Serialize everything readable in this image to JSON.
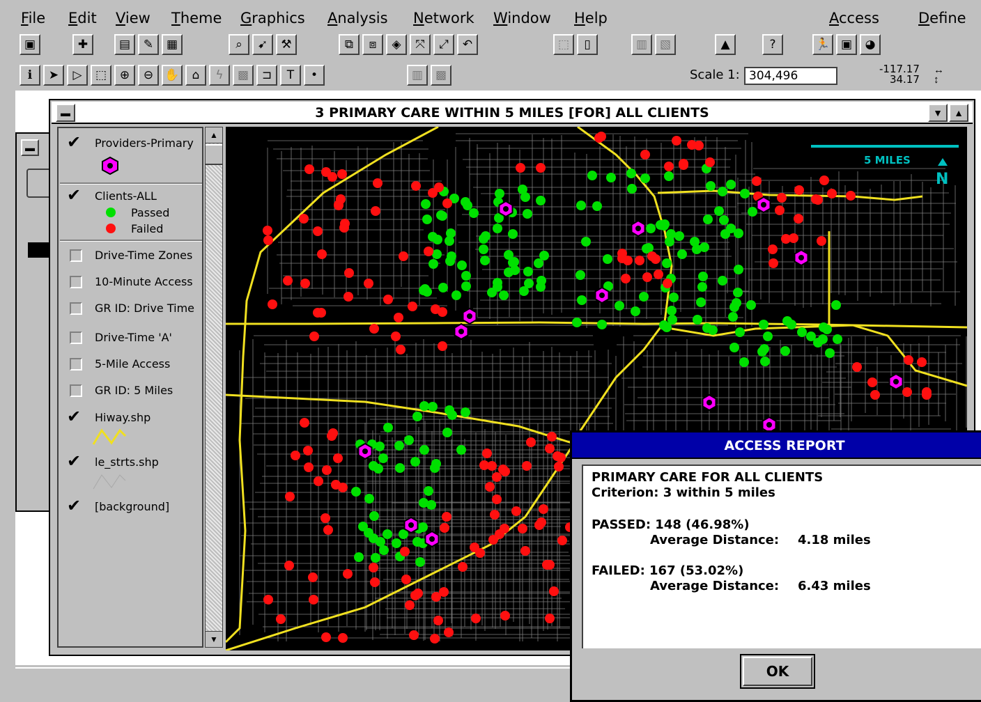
{
  "menubar": {
    "items": [
      "File",
      "Edit",
      "View",
      "Theme",
      "Graphics",
      "Analysis",
      "Network",
      "Window",
      "Help"
    ],
    "right_items": [
      "Access",
      "Define"
    ]
  },
  "toolbar": {
    "scale_label": "Scale 1:",
    "scale_value": "304,496",
    "coord_x": "-117.17",
    "coord_y": "34.17"
  },
  "view": {
    "title": "3 PRIMARY CARE WITHIN 5 MILES  [FOR]  ALL CLIENTS"
  },
  "legend": {
    "layers": [
      {
        "label": "Providers-Primary",
        "checked": true
      },
      {
        "label": "Clients-ALL",
        "checked": true,
        "sub": [
          "Passed",
          "Failed"
        ]
      },
      {
        "label": "Drive-Time Zones",
        "checked": false
      },
      {
        "label": "10-Minute Access",
        "checked": false
      },
      {
        "label": "GR ID: Drive Time",
        "checked": false
      },
      {
        "label": "Drive-Time 'A'",
        "checked": false
      },
      {
        "label": "5-Mile Access",
        "checked": false
      },
      {
        "label": "GR ID: 5 Miles",
        "checked": false
      },
      {
        "label": "Hiway.shp",
        "checked": true
      },
      {
        "label": "le_strts.shp",
        "checked": true
      },
      {
        "label": "[background]",
        "checked": true
      }
    ]
  },
  "map": {
    "scalebar_label": "5 MILES",
    "north_label": "N",
    "colors": {
      "passed": "#00e000",
      "failed": "#ff1010",
      "provider": "#ff00ff",
      "highway": "#f0e020",
      "scalebar": "#00c0c0"
    }
  },
  "dialog": {
    "title": "ACCESS REPORT",
    "line1": "PRIMARY CARE FOR ALL CLIENTS",
    "line2": "Criterion:  3 within 5 miles",
    "passed": "PASSED: 148  (46.98%)",
    "passed_avg_label": "Average Distance:",
    "passed_avg_value": "4.18 miles",
    "failed": "FAILED: 167  (53.02%)",
    "failed_avg_label": "Average Distance:",
    "failed_avg_value": "6.43 miles",
    "ok_label": "OK"
  }
}
